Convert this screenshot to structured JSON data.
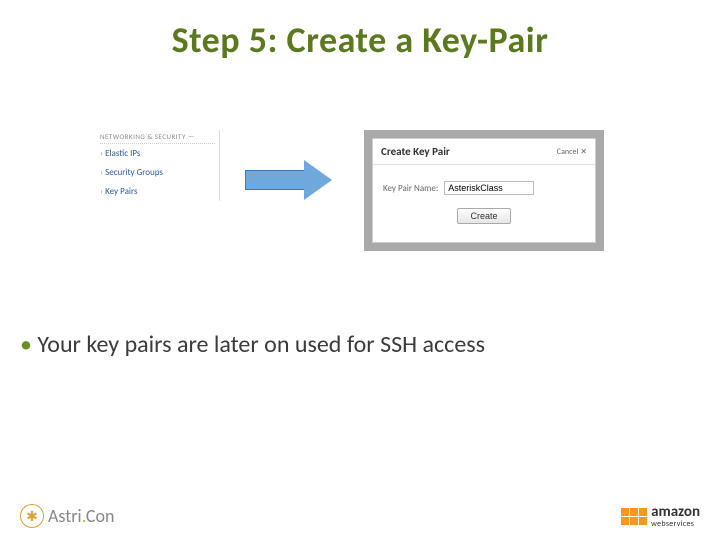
{
  "title": "Step 5: Create a Key-Pair",
  "nav": {
    "header": "NETWORKING & SECURITY —",
    "items": [
      "Elastic IPs",
      "Security Groups",
      "Key Pairs"
    ]
  },
  "dialog": {
    "title": "Create Key Pair",
    "cancel": "Cancel",
    "field_label": "Key Pair Name:",
    "field_value": "AsteriskClass",
    "create_button": "Create"
  },
  "bullet": " Your key pairs are later on used for SSH access",
  "footer": {
    "left": {
      "part1": "Astri",
      "part2": ".",
      "part3": "Con"
    },
    "right": {
      "line1": "amazon",
      "line2": "webservices"
    }
  }
}
